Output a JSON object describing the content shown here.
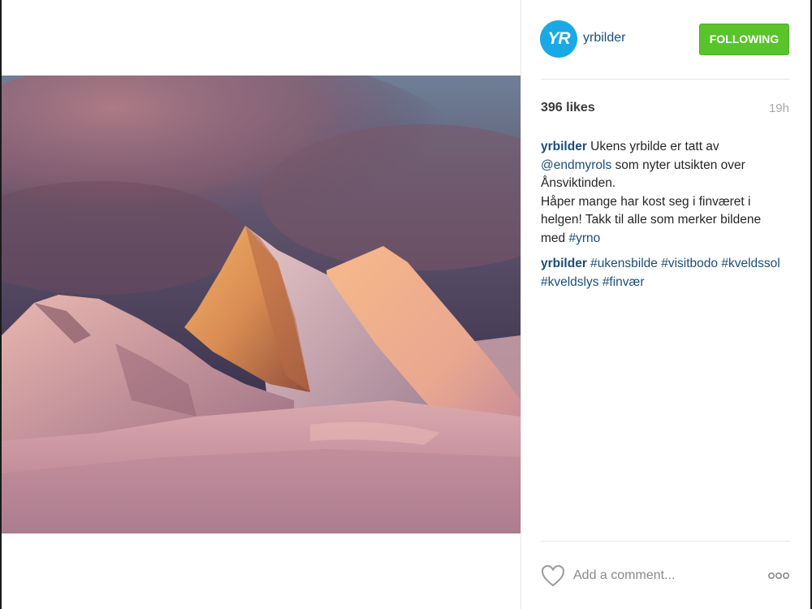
{
  "post": {
    "username": "yrbilder",
    "avatar_text": "YR",
    "follow_label": "FOLLOWING",
    "likes": "396 likes",
    "time": "19h",
    "caption": {
      "author": "yrbilder",
      "line1_text": " Ukens yrbilde er tatt av",
      "mention": "@endmyrols",
      "line2_text": " som nyter utsikten over",
      "line3_text": "Ånsviktinden.",
      "line4_text": "Håper mange har kost seg i finværet i",
      "line5_text": "helgen! Takk til alle som merker bildene",
      "line6_text": "med ",
      "hashtag": "#yrno"
    },
    "comment": {
      "author": "yrbilder",
      "tags": [
        "#ukensbilde",
        "#visitbodo",
        "#kveldssol",
        "#kveldslys",
        "#finvær"
      ]
    },
    "add_comment_placeholder": "Add a comment...",
    "more_label": "ooo"
  },
  "colors": {
    "follow_bg": "#59c32b",
    "link": "#1b4d78",
    "avatar_bg": "#19a9e5",
    "time": "#a5a7aa"
  },
  "icons": {
    "like": "heart-outline-icon",
    "more": "more-options-icon"
  }
}
